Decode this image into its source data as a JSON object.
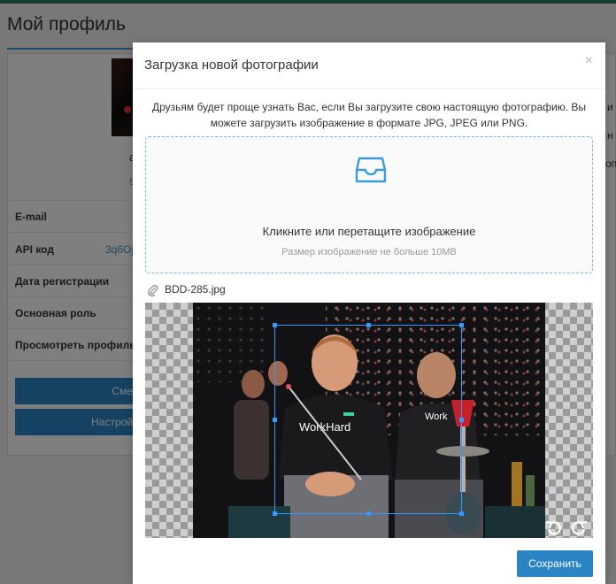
{
  "page": {
    "title": "Мой профиль",
    "name_fragment": "а",
    "sub_fragment": "5"
  },
  "profile": {
    "rows": [
      {
        "label": "E-mail"
      },
      {
        "label": "API код",
        "value": "3q6Oj"
      },
      {
        "label": "Дата регистрации"
      },
      {
        "label": "Основная роль"
      },
      {
        "label": "Просмотреть профиль"
      }
    ],
    "buttons": [
      {
        "label": "Сме"
      },
      {
        "label": "Настрой"
      }
    ]
  },
  "right_fragments": [
    "и",
    "н",
    "оп"
  ],
  "modal": {
    "title": "Загрузка новой фотографии",
    "close": "×",
    "description": "Друзьям будет проще узнать Вас, если Вы загрузите свою настоящую фотографию. Вы можете загрузить изображение в формате JPG, JPEG или PNG.",
    "dropzone": {
      "text": "Кликните или перетащите изображение",
      "hint": "Размер изображение не больше 10MB"
    },
    "file_name": "BDD-285.jpg",
    "photo": {
      "shirt_text_1": "WorkHard",
      "shirt_text_2": "Work"
    },
    "save_label": "Сохранить"
  },
  "colors": {
    "accent": "#2b84c4",
    "crop_border": "#3399ff",
    "dropzone_border": "#6fbde6",
    "topbar": "#2e7d5a"
  }
}
